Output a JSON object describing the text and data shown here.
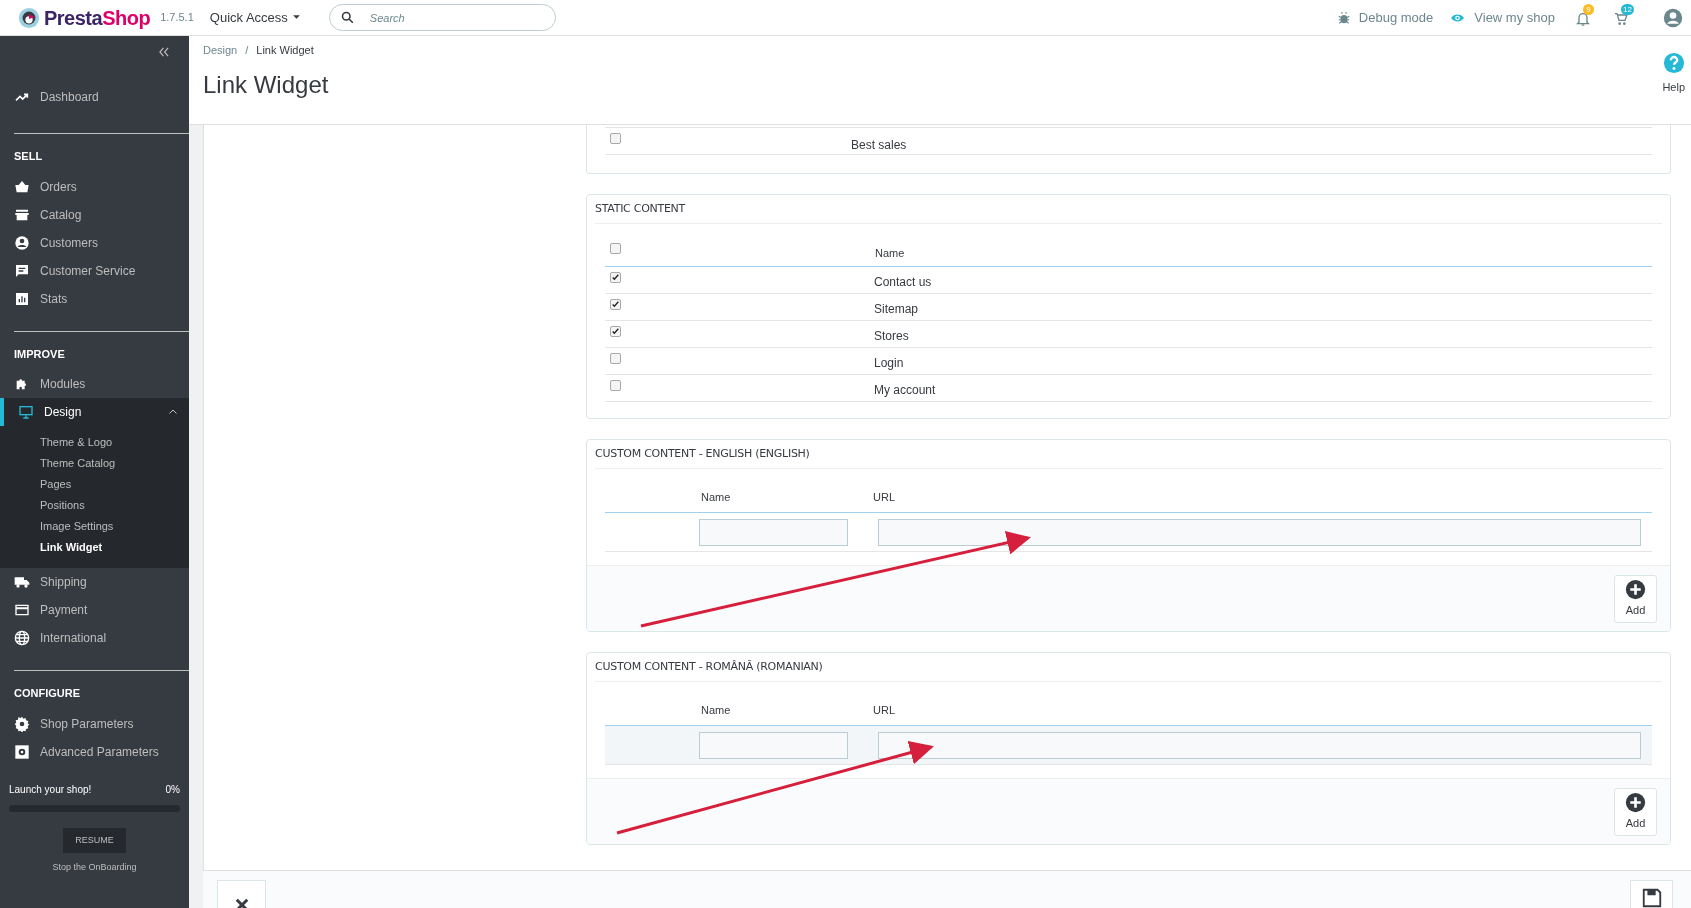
{
  "header": {
    "logo": [
      "Presta",
      "Shop"
    ],
    "version": "1.7.5.1",
    "quick_access": "Quick Access",
    "search": {
      "placeholder": "Search"
    },
    "debug": "Debug mode",
    "view_shop": "View my shop",
    "notifications": "9",
    "orders": "12"
  },
  "sidebar": {
    "top": [
      {
        "label": "Dashboard"
      }
    ],
    "sections": [
      {
        "title": "SELL",
        "items": [
          {
            "label": "Orders",
            "selected": false
          },
          {
            "label": "Catalog",
            "selected": false
          },
          {
            "label": "Customers",
            "selected": false
          },
          {
            "label": "Customer Service",
            "selected": false
          },
          {
            "label": "Stats",
            "selected": false
          }
        ]
      },
      {
        "title": "IMPROVE",
        "items": [
          {
            "label": "Modules",
            "selected": false
          },
          {
            "label": "Design",
            "selected": true,
            "expanded": true,
            "children": [
              {
                "label": "Theme & Logo",
                "selected": false
              },
              {
                "label": "Theme Catalog",
                "selected": false
              },
              {
                "label": "Pages",
                "selected": false
              },
              {
                "label": "Positions",
                "selected": false
              },
              {
                "label": "Image Settings",
                "selected": false
              },
              {
                "label": "Link Widget",
                "selected": true
              }
            ]
          },
          {
            "label": "Shipping",
            "selected": false
          },
          {
            "label": "Payment",
            "selected": false
          },
          {
            "label": "International",
            "selected": false
          }
        ]
      },
      {
        "title": "CONFIGURE",
        "items": [
          {
            "label": "Shop Parameters",
            "selected": false
          },
          {
            "label": "Advanced Parameters",
            "selected": false
          }
        ]
      }
    ],
    "onboarding": {
      "label": "Launch your shop!",
      "percent": "0%",
      "button": "RESUME",
      "stop": "Stop the OnBoarding"
    }
  },
  "breadcrumb": [
    "Design",
    "Link Widget"
  ],
  "breadcrumb_separator": "/",
  "page_title": "Link Widget",
  "help": "Help",
  "partial_panel": {
    "rows": [
      {
        "name": "Best sales",
        "checked": false
      }
    ]
  },
  "static_panel": {
    "title": "STATIC CONTENT",
    "column": "Name",
    "all_checked": false,
    "rows": [
      {
        "name": "Contact us",
        "checked": true
      },
      {
        "name": "Sitemap",
        "checked": true
      },
      {
        "name": "Stores",
        "checked": true
      },
      {
        "name": "Login",
        "checked": false
      },
      {
        "name": "My account",
        "checked": false
      }
    ]
  },
  "custom_panels": [
    {
      "title": "CUSTOM CONTENT - ENGLISH (ENGLISH)",
      "columns": [
        "Name",
        "URL"
      ],
      "highlighted": false,
      "add": "Add"
    },
    {
      "title": "CUSTOM CONTENT - ROMÂNĂ (ROMANIAN)",
      "columns": [
        "Name",
        "URL"
      ],
      "highlighted": true,
      "add": "Add"
    }
  ]
}
